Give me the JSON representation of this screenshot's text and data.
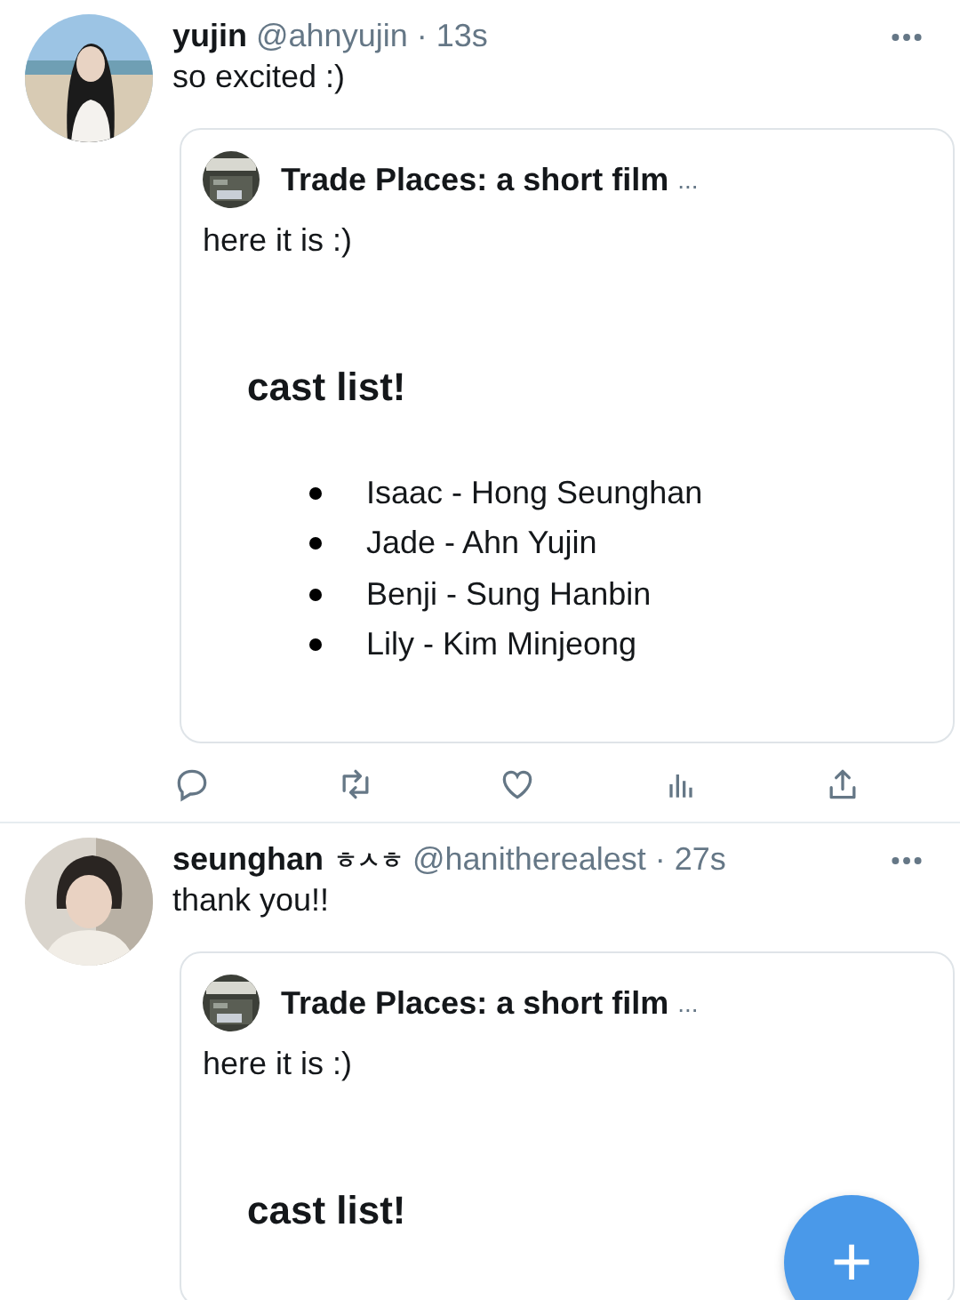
{
  "tweets": [
    {
      "name": "yujin",
      "handle": "@ahnyujin",
      "sep": "·",
      "time": "13s",
      "text": "so excited :)",
      "quote": {
        "title": "Trade Places: a short film",
        "more": "...",
        "text": "here it is :)",
        "heading": "cast list!",
        "items": [
          "Isaac - Hong Seunghan",
          "Jade - Ahn Yujin",
          "Benji - Sung Hanbin",
          "Lily - Kim Minjeong"
        ]
      }
    },
    {
      "name": "seunghan",
      "badge": "ㅎㅅㅎ",
      "handle": "@hanitherealest",
      "sep": "·",
      "time": "27s",
      "text": "thank you!!",
      "quote": {
        "title": "Trade Places: a short film",
        "more": "...",
        "text": "here it is :)",
        "heading": "cast list!"
      }
    }
  ],
  "compose_button": {
    "label": "+"
  }
}
